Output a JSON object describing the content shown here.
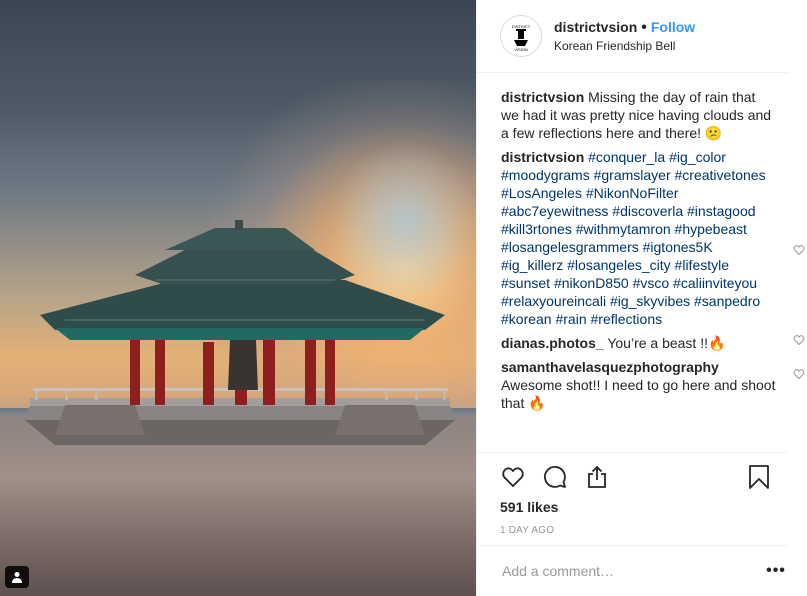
{
  "post": {
    "username": "districtvsion",
    "follow_label": "Follow",
    "separator": "•",
    "location": "Korean Friendship Bell",
    "avatar_text": "DISTRICT"
  },
  "comments": [
    {
      "username": "districtvsion",
      "text": "Missing the day of rain that we had it was pretty nice having clouds and a few reflections here and there! 😕",
      "likeable": false
    },
    {
      "username": "districtvsion",
      "hashtags": [
        "#conquer_la",
        "#ig_color",
        "#moodygrams",
        "#gramslayer",
        "#creativetones",
        "#LosAngeles",
        "#NikonNoFilter",
        "#abc7eyewitness",
        "#discoverla",
        "#instagood",
        "#kill3rtones",
        "#withmytamron",
        "#hypebeast",
        "#losangelesgrammers",
        "#igtones5K",
        "#ig_killerz",
        "#losangeles_city",
        "#lifestyle",
        "#sunset",
        "#nikonD850",
        "#vsco",
        "#caliinviteyou",
        "#relaxyoureincali",
        "#ig_skyvibes",
        "#sanpedro",
        "#korean",
        "#rain",
        "#reflections"
      ],
      "likeable": true
    },
    {
      "username": "dianas.photos_",
      "text": "You’re a beast !!🔥",
      "likeable": true
    },
    {
      "username": "samanthavelasquezphotography",
      "text": "Awesome shot!! I need to go here and shoot that 🔥",
      "likeable": true
    }
  ],
  "likes": "591 likes",
  "timestamp": "1 DAY AGO",
  "add_comment_placeholder": "Add a comment…",
  "more_label": "•••",
  "colors": {
    "link": "#3897f0",
    "hashtag": "#003569",
    "text": "#262626",
    "muted": "#999999"
  },
  "icons": [
    "heart-icon",
    "comment-icon",
    "share-icon",
    "bookmark-icon",
    "user-tag-icon",
    "more-options-icon"
  ]
}
